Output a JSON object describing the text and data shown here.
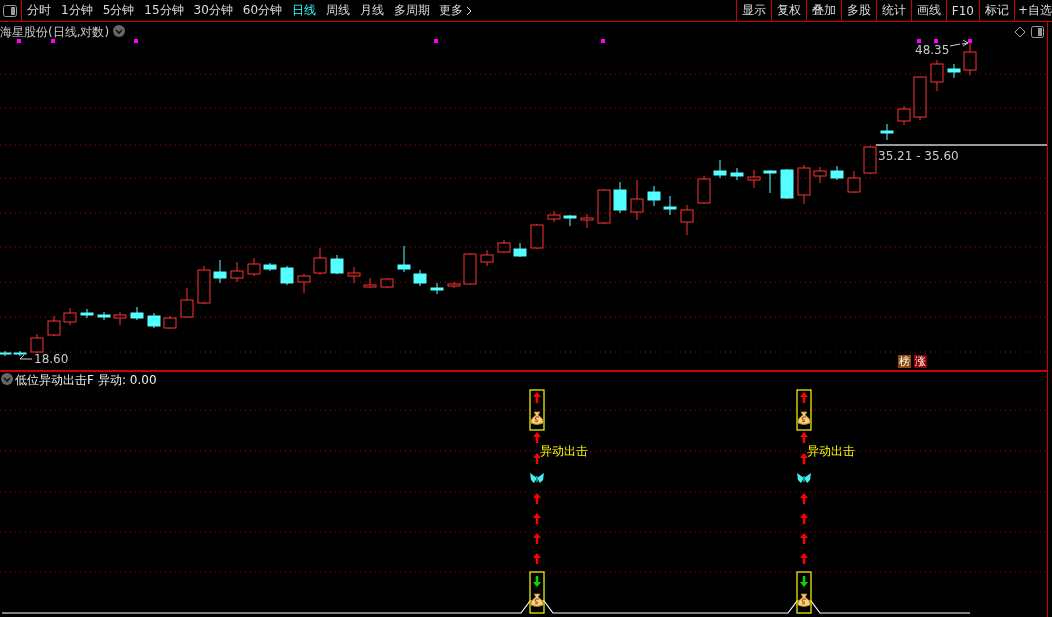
{
  "toolbar": {
    "periods": [
      {
        "label": "分时",
        "selected": false
      },
      {
        "label": "1分钟",
        "selected": false
      },
      {
        "label": "5分钟",
        "selected": false
      },
      {
        "label": "15分钟",
        "selected": false
      },
      {
        "label": "30分钟",
        "selected": false
      },
      {
        "label": "60分钟",
        "selected": false
      },
      {
        "label": "日线",
        "selected": true
      },
      {
        "label": "周线",
        "selected": false
      },
      {
        "label": "月线",
        "selected": false
      },
      {
        "label": "多周期",
        "selected": false
      }
    ],
    "more": "更多",
    "actions": [
      "显示",
      "复权",
      "叠加",
      "多股",
      "统计",
      "画线",
      "F10",
      "标记",
      "+自选"
    ]
  },
  "chart": {
    "title": "海星股份(日线,对数)",
    "high_label": "48.35",
    "low_label": "18.60",
    "range_label": "35.21 - 35.60",
    "badges": [
      {
        "text": "榜",
        "color": "#8b4a0b"
      },
      {
        "text": "涨",
        "color": "#8b0000"
      }
    ]
  },
  "indicator": {
    "title": "低位异动出击F",
    "value": "异动: 0.00",
    "signals": [
      {
        "label": "异动出击"
      },
      {
        "label": "异动出击"
      }
    ]
  }
}
